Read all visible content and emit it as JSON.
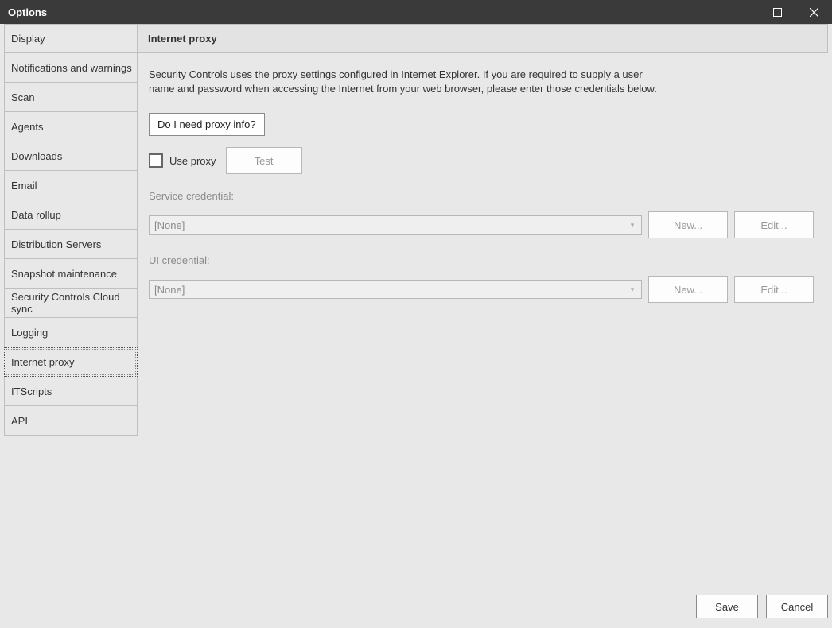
{
  "window": {
    "title": "Options"
  },
  "sidebar": {
    "items": [
      {
        "label": "Display"
      },
      {
        "label": "Notifications and warnings"
      },
      {
        "label": "Scan"
      },
      {
        "label": "Agents"
      },
      {
        "label": "Downloads"
      },
      {
        "label": "Email"
      },
      {
        "label": "Data rollup"
      },
      {
        "label": "Distribution Servers"
      },
      {
        "label": "Snapshot maintenance"
      },
      {
        "label": "Security Controls Cloud sync"
      },
      {
        "label": "Logging"
      },
      {
        "label": "Internet proxy"
      },
      {
        "label": "ITScripts"
      },
      {
        "label": "API"
      }
    ],
    "selected_index": 11
  },
  "panel": {
    "title": "Internet proxy",
    "description": "Security Controls uses the proxy settings configured in Internet Explorer. If you are required to supply a user name and password when accessing the Internet from your web browser, please enter those credentials below.",
    "proxy_info_link": "Do I need proxy info?",
    "use_proxy_checkbox": {
      "label": "Use proxy",
      "checked": false
    },
    "test_button": "Test",
    "service_credential_label": "Service credential:",
    "service_credential_value": "[None]",
    "ui_credential_label": "UI credential:",
    "ui_credential_value": "[None]",
    "new_button": "New...",
    "edit_button": "Edit...",
    "help_glyph": "?"
  },
  "footer": {
    "save": "Save",
    "cancel": "Cancel"
  }
}
